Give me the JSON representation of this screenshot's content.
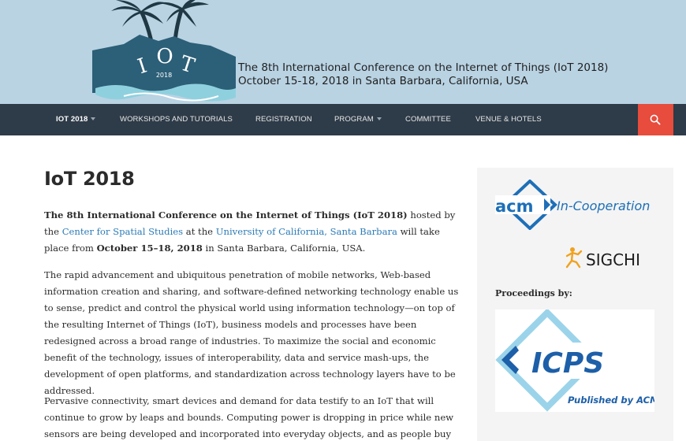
{
  "header": {
    "logo_text": "IOT",
    "logo_year": "2018",
    "title_line1": "The 8th International Conference on the Internet of Things (IoT 2018)",
    "title_line2": "October 15-18, 2018 in Santa Barbara, California, USA"
  },
  "nav": {
    "items": [
      {
        "label": "IoT 2018",
        "has_dropdown": true,
        "active": true
      },
      {
        "label": "Workshops and Tutorials",
        "has_dropdown": false
      },
      {
        "label": "Registration",
        "has_dropdown": false
      },
      {
        "label": "Program",
        "has_dropdown": true
      },
      {
        "label": "Committee",
        "has_dropdown": false
      },
      {
        "label": "Venue & Hotels",
        "has_dropdown": false
      }
    ],
    "search_icon": "search-icon",
    "search_color": "#e74c3c",
    "bar_color": "#2e3b48"
  },
  "main": {
    "title": "IoT 2018",
    "p1": {
      "bold_intro": "The 8th International Conference on the Internet of Things (IoT 2018)",
      "t1": " hosted by the ",
      "link1": "Center for Spatial Studies",
      "t2": " at the ",
      "link2": "University of California, Santa Barbara",
      "t3": " will take place from ",
      "bold_dates": "October 15–18, 2018",
      "t4": " in Santa Barbara, California, USA."
    },
    "p2": "The rapid advancement and ubiquitous penetration of mobile networks, Web-based information creation and sharing, and software-defined networking technology enable us to sense, predict and control the physical world using information technology—on top of the resulting Internet of Things (IoT), business models and processes have been redesigned across a broad range of industries. To maximize the social and economic benefit of the technology, issues of interoperability, data and service mash-ups, the development of open platforms, and standardization across technology layers have to be addressed.",
    "p3": "Pervasive connectivity, smart devices and demand for data testify to an IoT that will continue to grow by leaps and bounds. Computing power is dropping in price while new sensors are being developed and incorporated into everyday objects, and as people buy"
  },
  "sidebar": {
    "acm_text": "acm",
    "acm_tagline": "In-Cooperation",
    "sigchi_text": "SIGCHI",
    "proceedings_label": "Proceedings by:",
    "icps_text": "ICPS",
    "icps_tagline": "Published by ACM"
  },
  "colors": {
    "header_bg": "#b9d3e3",
    "link": "#2c7bb6",
    "acm_blue": "#1d6fb8",
    "icps_blue": "#1d5fa8"
  }
}
